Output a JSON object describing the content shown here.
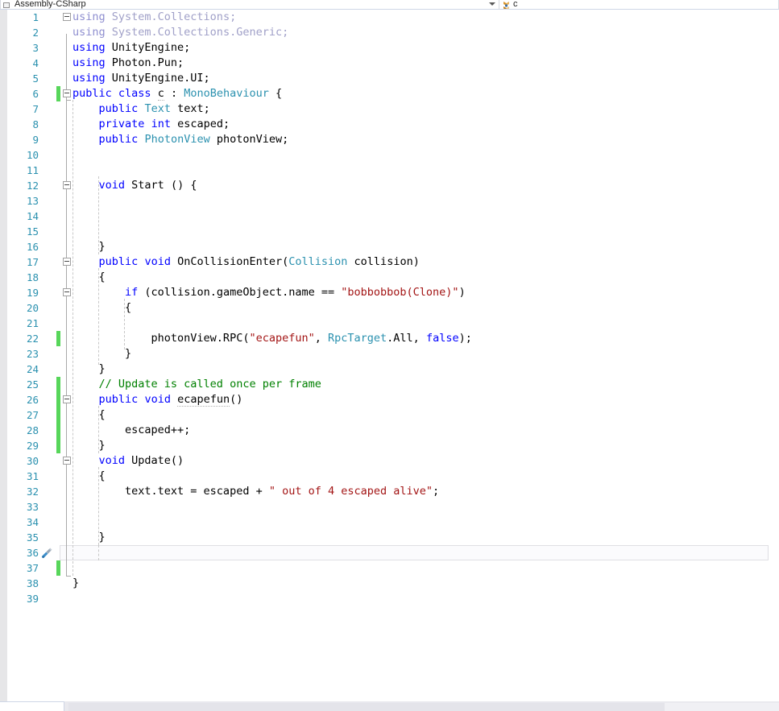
{
  "navbar": {
    "project_name": "Assembly-CSharp",
    "project_icon": "project-icon",
    "member_name": "c",
    "member_icon": "class-icon",
    "dropdown_icon": "chevron-down-icon"
  },
  "editor": {
    "language": "csharp",
    "first_visible_line": 1,
    "total_visible_lines": 39,
    "current_line": 36,
    "gutter_quick_action_icon": "screwdriver-icon",
    "colors": {
      "keyword": "#0000ff",
      "type": "#2b91af",
      "string": "#a31515",
      "comment": "#008000",
      "line_number": "#2b91af",
      "change_bar_unsaved": "#57d65a",
      "background": "#ffffff"
    },
    "change_bar_lines": [
      6,
      22,
      25,
      26,
      27,
      28,
      29,
      37
    ],
    "fold_lines": [
      1,
      6,
      12,
      17,
      19,
      26,
      30
    ],
    "lines": [
      {
        "n": 1,
        "tokens": [
          {
            "t": "using",
            "c": "dimkw"
          },
          {
            "t": " System.Collections;",
            "c": "dim"
          }
        ]
      },
      {
        "n": 2,
        "tokens": [
          {
            "t": "using",
            "c": "dimkw"
          },
          {
            "t": " System.Collections.Generic;",
            "c": "dim"
          }
        ]
      },
      {
        "n": 3,
        "tokens": [
          {
            "t": "using",
            "c": "kw"
          },
          {
            "t": " UnityEngine;",
            "c": "plain"
          }
        ]
      },
      {
        "n": 4,
        "tokens": [
          {
            "t": "using",
            "c": "kw"
          },
          {
            "t": " Photon.Pun;",
            "c": "plain"
          }
        ]
      },
      {
        "n": 5,
        "tokens": [
          {
            "t": "using",
            "c": "kw"
          },
          {
            "t": " UnityEngine.UI;",
            "c": "plain"
          }
        ]
      },
      {
        "n": 6,
        "tokens": [
          {
            "t": "public",
            "c": "kw"
          },
          {
            "t": " ",
            "c": "plain"
          },
          {
            "t": "class",
            "c": "kw"
          },
          {
            "t": " ",
            "c": "plain"
          },
          {
            "t": "c",
            "c": "plain sug"
          },
          {
            "t": " : ",
            "c": "plain"
          },
          {
            "t": "MonoBehaviour",
            "c": "type"
          },
          {
            "t": " {",
            "c": "plain"
          }
        ]
      },
      {
        "n": 7,
        "tokens": [
          {
            "t": "    ",
            "c": "plain"
          },
          {
            "t": "public",
            "c": "kw"
          },
          {
            "t": " ",
            "c": "plain"
          },
          {
            "t": "Text",
            "c": "type"
          },
          {
            "t": " text;",
            "c": "plain"
          }
        ]
      },
      {
        "n": 8,
        "tokens": [
          {
            "t": "    ",
            "c": "plain"
          },
          {
            "t": "private",
            "c": "kw"
          },
          {
            "t": " ",
            "c": "plain"
          },
          {
            "t": "int",
            "c": "kw"
          },
          {
            "t": " escaped;",
            "c": "plain"
          }
        ]
      },
      {
        "n": 9,
        "tokens": [
          {
            "t": "    ",
            "c": "plain"
          },
          {
            "t": "public",
            "c": "kw"
          },
          {
            "t": " ",
            "c": "plain"
          },
          {
            "t": "PhotonView",
            "c": "type"
          },
          {
            "t": " photonView;",
            "c": "plain"
          }
        ]
      },
      {
        "n": 10,
        "tokens": []
      },
      {
        "n": 11,
        "tokens": []
      },
      {
        "n": 12,
        "tokens": [
          {
            "t": "    ",
            "c": "plain"
          },
          {
            "t": "void",
            "c": "kw"
          },
          {
            "t": " ",
            "c": "plain"
          },
          {
            "t": "Start",
            "c": "plain"
          },
          {
            "t": " () {",
            "c": "plain"
          }
        ]
      },
      {
        "n": 13,
        "tokens": []
      },
      {
        "n": 14,
        "tokens": []
      },
      {
        "n": 15,
        "tokens": []
      },
      {
        "n": 16,
        "tokens": [
          {
            "t": "    }",
            "c": "plain"
          }
        ]
      },
      {
        "n": 17,
        "tokens": [
          {
            "t": "    ",
            "c": "plain"
          },
          {
            "t": "public",
            "c": "kw"
          },
          {
            "t": " ",
            "c": "plain"
          },
          {
            "t": "void",
            "c": "kw"
          },
          {
            "t": " OnCollisionEnter(",
            "c": "plain"
          },
          {
            "t": "Collision",
            "c": "type"
          },
          {
            "t": " collision)",
            "c": "plain"
          }
        ]
      },
      {
        "n": 18,
        "tokens": [
          {
            "t": "    {",
            "c": "plain"
          }
        ]
      },
      {
        "n": 19,
        "tokens": [
          {
            "t": "        ",
            "c": "plain"
          },
          {
            "t": "if",
            "c": "kw"
          },
          {
            "t": " (collision.gameObject.name == ",
            "c": "plain"
          },
          {
            "t": "\"bobbobbob(Clone)\"",
            "c": "str"
          },
          {
            "t": ")",
            "c": "plain"
          }
        ]
      },
      {
        "n": 20,
        "tokens": [
          {
            "t": "        {",
            "c": "plain"
          }
        ]
      },
      {
        "n": 21,
        "tokens": []
      },
      {
        "n": 22,
        "tokens": [
          {
            "t": "            photonView.RPC(",
            "c": "plain"
          },
          {
            "t": "\"ecapefun\"",
            "c": "str"
          },
          {
            "t": ", ",
            "c": "plain"
          },
          {
            "t": "RpcTarget",
            "c": "type"
          },
          {
            "t": ".All, ",
            "c": "plain"
          },
          {
            "t": "false",
            "c": "kw"
          },
          {
            "t": ");",
            "c": "plain"
          }
        ]
      },
      {
        "n": 23,
        "tokens": [
          {
            "t": "        }",
            "c": "plain"
          }
        ]
      },
      {
        "n": 24,
        "tokens": [
          {
            "t": "    }",
            "c": "plain"
          }
        ]
      },
      {
        "n": 25,
        "tokens": [
          {
            "t": "    // Update is called once per frame",
            "c": "cmt"
          }
        ]
      },
      {
        "n": 26,
        "tokens": [
          {
            "t": "    ",
            "c": "plain"
          },
          {
            "t": "public",
            "c": "kw"
          },
          {
            "t": " ",
            "c": "plain"
          },
          {
            "t": "void",
            "c": "kw"
          },
          {
            "t": " ",
            "c": "plain"
          },
          {
            "t": "ecapefun",
            "c": "plain sug"
          },
          {
            "t": "()",
            "c": "plain"
          }
        ]
      },
      {
        "n": 27,
        "tokens": [
          {
            "t": "    {",
            "c": "plain"
          }
        ]
      },
      {
        "n": 28,
        "tokens": [
          {
            "t": "        escaped++;",
            "c": "plain"
          }
        ]
      },
      {
        "n": 29,
        "tokens": [
          {
            "t": "    }",
            "c": "plain"
          }
        ]
      },
      {
        "n": 30,
        "tokens": [
          {
            "t": "    ",
            "c": "plain"
          },
          {
            "t": "void",
            "c": "kw"
          },
          {
            "t": " Update()",
            "c": "plain"
          }
        ]
      },
      {
        "n": 31,
        "tokens": [
          {
            "t": "    {",
            "c": "plain"
          }
        ]
      },
      {
        "n": 32,
        "tokens": [
          {
            "t": "        text.text = escaped + ",
            "c": "plain"
          },
          {
            "t": "\" out of 4 escaped alive\"",
            "c": "str"
          },
          {
            "t": ";",
            "c": "plain"
          }
        ]
      },
      {
        "n": 33,
        "tokens": []
      },
      {
        "n": 34,
        "tokens": []
      },
      {
        "n": 35,
        "tokens": [
          {
            "t": "    }",
            "c": "plain"
          }
        ]
      },
      {
        "n": 36,
        "tokens": []
      },
      {
        "n": 37,
        "tokens": []
      },
      {
        "n": 38,
        "tokens": [
          {
            "t": "}",
            "c": "plain"
          }
        ]
      },
      {
        "n": 39,
        "tokens": []
      }
    ]
  },
  "scrollbar": {
    "horizontal_thumb_label": "horizontal-scrollbar-thumb"
  }
}
